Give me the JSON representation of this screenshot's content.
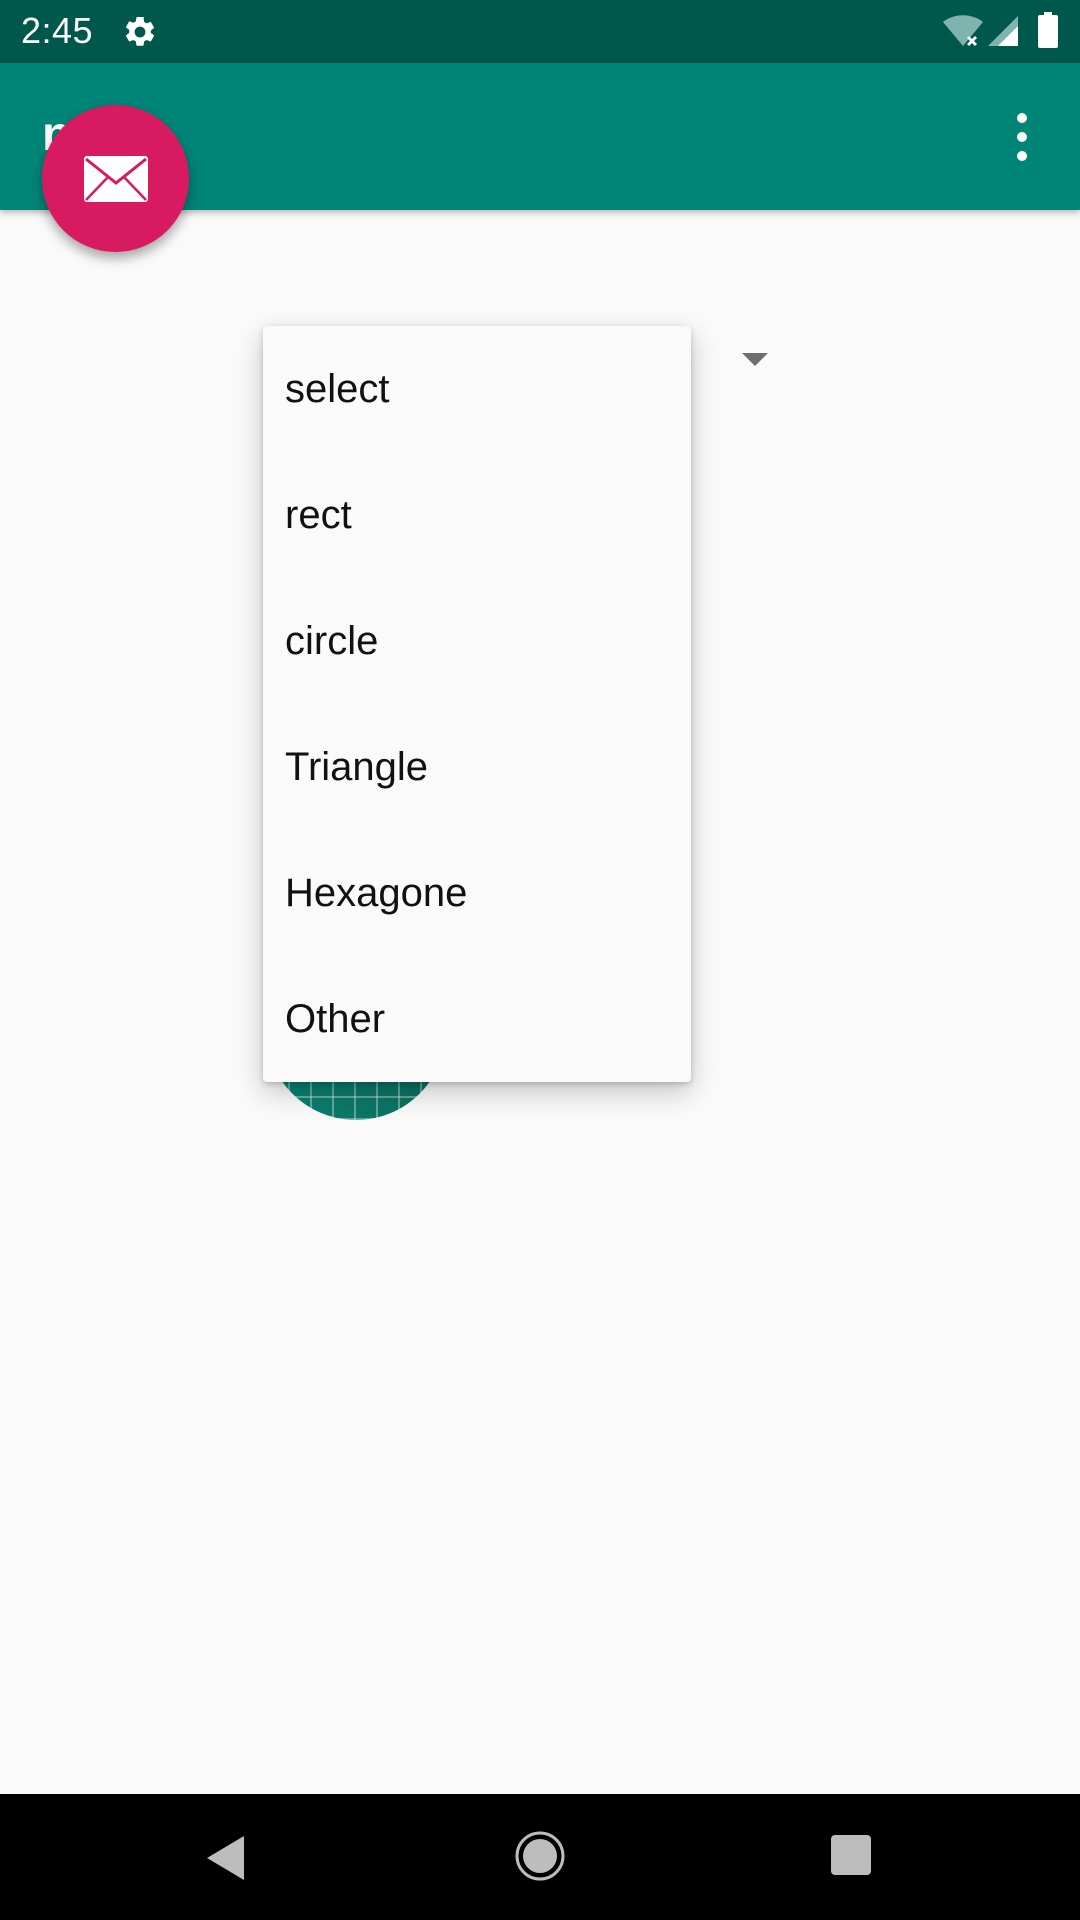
{
  "status_bar": {
    "time": "2:45",
    "icons": [
      "gear-icon",
      "wifi-off-icon",
      "cell-signal-icon",
      "battery-icon"
    ]
  },
  "app_bar": {
    "title": "n   ?",
    "overflow_icon": "more-vert-icon"
  },
  "fab": {
    "icon": "mail-icon",
    "color": "#d81b60"
  },
  "dropdown": {
    "items": [
      {
        "label": "select"
      },
      {
        "label": "rect"
      },
      {
        "label": "circle"
      },
      {
        "label": "Triangle"
      },
      {
        "label": "Hexagone"
      },
      {
        "label": "Other"
      }
    ]
  },
  "nav_bar": {
    "icons": [
      "back-icon",
      "home-icon",
      "recents-icon"
    ]
  },
  "colors": {
    "status_bar": "#00574b",
    "app_bar": "#008577",
    "accent": "#d81b60",
    "background": "#fafafa"
  }
}
